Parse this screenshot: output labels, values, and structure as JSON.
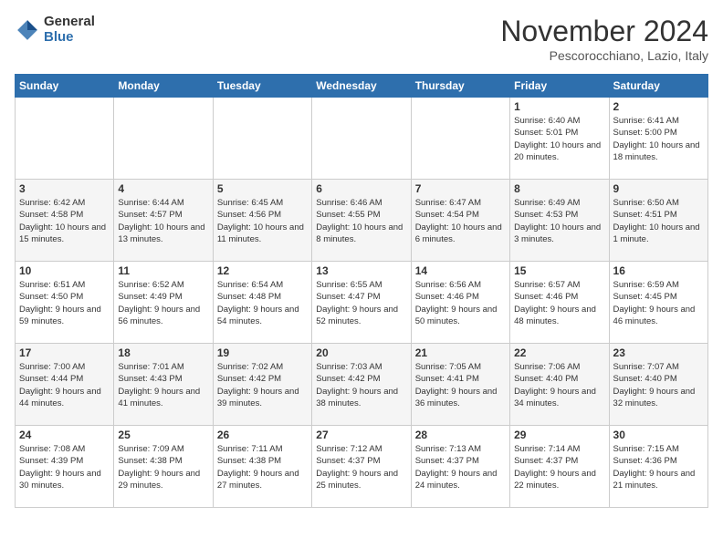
{
  "logo": {
    "general": "General",
    "blue": "Blue"
  },
  "title": "November 2024",
  "subtitle": "Pescorocchiano, Lazio, Italy",
  "days_of_week": [
    "Sunday",
    "Monday",
    "Tuesday",
    "Wednesday",
    "Thursday",
    "Friday",
    "Saturday"
  ],
  "weeks": [
    [
      {
        "day": "",
        "info": ""
      },
      {
        "day": "",
        "info": ""
      },
      {
        "day": "",
        "info": ""
      },
      {
        "day": "",
        "info": ""
      },
      {
        "day": "",
        "info": ""
      },
      {
        "day": "1",
        "info": "Sunrise: 6:40 AM\nSunset: 5:01 PM\nDaylight: 10 hours and 20 minutes."
      },
      {
        "day": "2",
        "info": "Sunrise: 6:41 AM\nSunset: 5:00 PM\nDaylight: 10 hours and 18 minutes."
      }
    ],
    [
      {
        "day": "3",
        "info": "Sunrise: 6:42 AM\nSunset: 4:58 PM\nDaylight: 10 hours and 15 minutes."
      },
      {
        "day": "4",
        "info": "Sunrise: 6:44 AM\nSunset: 4:57 PM\nDaylight: 10 hours and 13 minutes."
      },
      {
        "day": "5",
        "info": "Sunrise: 6:45 AM\nSunset: 4:56 PM\nDaylight: 10 hours and 11 minutes."
      },
      {
        "day": "6",
        "info": "Sunrise: 6:46 AM\nSunset: 4:55 PM\nDaylight: 10 hours and 8 minutes."
      },
      {
        "day": "7",
        "info": "Sunrise: 6:47 AM\nSunset: 4:54 PM\nDaylight: 10 hours and 6 minutes."
      },
      {
        "day": "8",
        "info": "Sunrise: 6:49 AM\nSunset: 4:53 PM\nDaylight: 10 hours and 3 minutes."
      },
      {
        "day": "9",
        "info": "Sunrise: 6:50 AM\nSunset: 4:51 PM\nDaylight: 10 hours and 1 minute."
      }
    ],
    [
      {
        "day": "10",
        "info": "Sunrise: 6:51 AM\nSunset: 4:50 PM\nDaylight: 9 hours and 59 minutes."
      },
      {
        "day": "11",
        "info": "Sunrise: 6:52 AM\nSunset: 4:49 PM\nDaylight: 9 hours and 56 minutes."
      },
      {
        "day": "12",
        "info": "Sunrise: 6:54 AM\nSunset: 4:48 PM\nDaylight: 9 hours and 54 minutes."
      },
      {
        "day": "13",
        "info": "Sunrise: 6:55 AM\nSunset: 4:47 PM\nDaylight: 9 hours and 52 minutes."
      },
      {
        "day": "14",
        "info": "Sunrise: 6:56 AM\nSunset: 4:46 PM\nDaylight: 9 hours and 50 minutes."
      },
      {
        "day": "15",
        "info": "Sunrise: 6:57 AM\nSunset: 4:46 PM\nDaylight: 9 hours and 48 minutes."
      },
      {
        "day": "16",
        "info": "Sunrise: 6:59 AM\nSunset: 4:45 PM\nDaylight: 9 hours and 46 minutes."
      }
    ],
    [
      {
        "day": "17",
        "info": "Sunrise: 7:00 AM\nSunset: 4:44 PM\nDaylight: 9 hours and 44 minutes."
      },
      {
        "day": "18",
        "info": "Sunrise: 7:01 AM\nSunset: 4:43 PM\nDaylight: 9 hours and 41 minutes."
      },
      {
        "day": "19",
        "info": "Sunrise: 7:02 AM\nSunset: 4:42 PM\nDaylight: 9 hours and 39 minutes."
      },
      {
        "day": "20",
        "info": "Sunrise: 7:03 AM\nSunset: 4:42 PM\nDaylight: 9 hours and 38 minutes."
      },
      {
        "day": "21",
        "info": "Sunrise: 7:05 AM\nSunset: 4:41 PM\nDaylight: 9 hours and 36 minutes."
      },
      {
        "day": "22",
        "info": "Sunrise: 7:06 AM\nSunset: 4:40 PM\nDaylight: 9 hours and 34 minutes."
      },
      {
        "day": "23",
        "info": "Sunrise: 7:07 AM\nSunset: 4:40 PM\nDaylight: 9 hours and 32 minutes."
      }
    ],
    [
      {
        "day": "24",
        "info": "Sunrise: 7:08 AM\nSunset: 4:39 PM\nDaylight: 9 hours and 30 minutes."
      },
      {
        "day": "25",
        "info": "Sunrise: 7:09 AM\nSunset: 4:38 PM\nDaylight: 9 hours and 29 minutes."
      },
      {
        "day": "26",
        "info": "Sunrise: 7:11 AM\nSunset: 4:38 PM\nDaylight: 9 hours and 27 minutes."
      },
      {
        "day": "27",
        "info": "Sunrise: 7:12 AM\nSunset: 4:37 PM\nDaylight: 9 hours and 25 minutes."
      },
      {
        "day": "28",
        "info": "Sunrise: 7:13 AM\nSunset: 4:37 PM\nDaylight: 9 hours and 24 minutes."
      },
      {
        "day": "29",
        "info": "Sunrise: 7:14 AM\nSunset: 4:37 PM\nDaylight: 9 hours and 22 minutes."
      },
      {
        "day": "30",
        "info": "Sunrise: 7:15 AM\nSunset: 4:36 PM\nDaylight: 9 hours and 21 minutes."
      }
    ]
  ]
}
